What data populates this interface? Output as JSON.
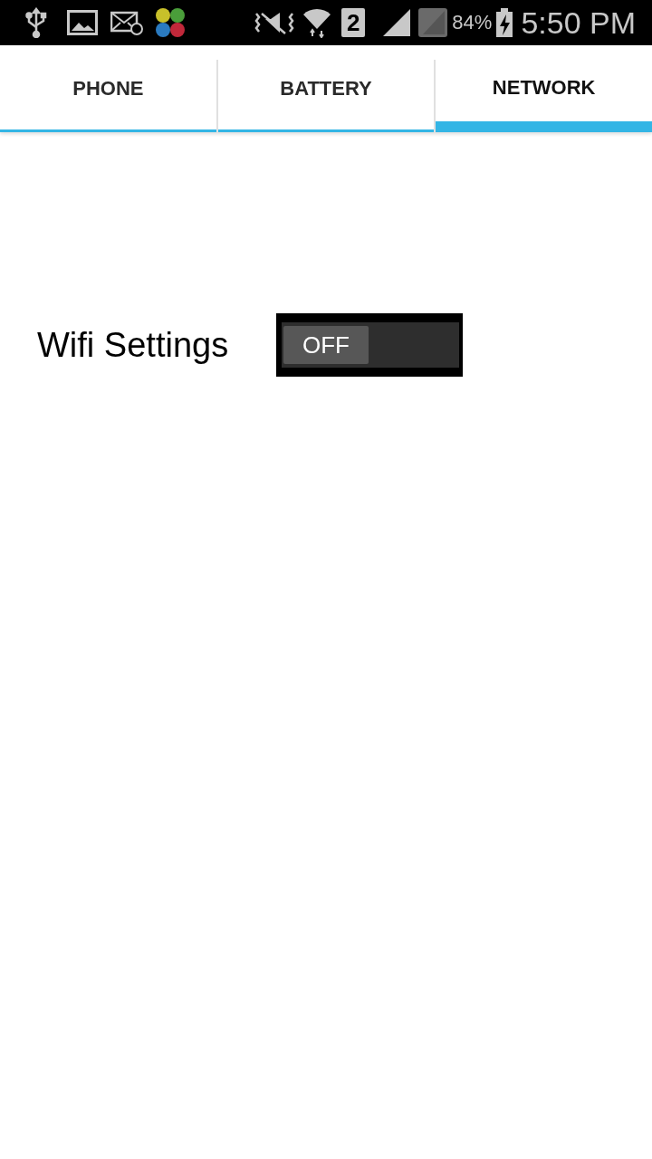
{
  "status_bar": {
    "sim_slot": "2",
    "battery_percent": "84%",
    "time": "5:50 PM"
  },
  "tabs": [
    {
      "label": "PHONE",
      "selected": false
    },
    {
      "label": "BATTERY",
      "selected": false
    },
    {
      "label": "NETWORK",
      "selected": true
    }
  ],
  "wifi_setting": {
    "label": "Wifi Settings",
    "switch": {
      "on": false,
      "label": "OFF"
    }
  }
}
